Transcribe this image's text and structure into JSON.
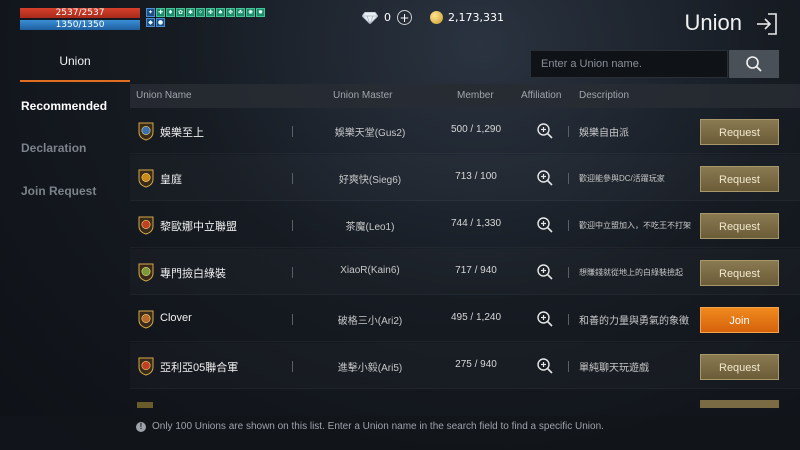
{
  "status": {
    "hp": "2537/2537",
    "mp": "1350/1350",
    "hp_fraction": 1.0,
    "mp_fraction": 1.0
  },
  "currency": {
    "diamonds": "0",
    "gold": "2,173,331"
  },
  "window": {
    "title": "Union"
  },
  "tab": {
    "label": "Union"
  },
  "search": {
    "placeholder": "Enter a Union name."
  },
  "sidebar": {
    "items": [
      {
        "label": "Recommended",
        "active": true
      },
      {
        "label": "Declaration",
        "active": false
      },
      {
        "label": "Join Request",
        "active": false
      }
    ]
  },
  "table": {
    "headers": {
      "name": "Union Name",
      "master": "Union Master",
      "member": "Member",
      "affiliation": "Affiliation",
      "description": "Description"
    },
    "rows": [
      {
        "name": "娛樂至上",
        "master": "娛樂天堂(Gus2)",
        "member": "500 / 1,290",
        "description": "娛樂自由派",
        "action": "Request",
        "emblem_color": "#3a6fb0"
      },
      {
        "name": "皇庭",
        "master": "好爽快(Sieg6)",
        "member": "713 / 100",
        "description": "歡迎能參與DC/活躍玩家",
        "action": "Request",
        "emblem_color": "#c98a1a"
      },
      {
        "name": "黎歐娜中立聯盟",
        "master": "茶魔(Leo1)",
        "member": "744 / 1,330",
        "description": "歡迎中立盟加入，不吃王不打架",
        "action": "Request",
        "emblem_color": "#c04020"
      },
      {
        "name": "專門撿白綠裝",
        "master": "XiaoR(Kain6)",
        "member": "717 / 940",
        "description": "想賺錢就從地上的白綠裝撿起",
        "action": "Request",
        "emblem_color": "#7a9a3a"
      },
      {
        "name": "Clover",
        "master": "破格三小(Ari2)",
        "member": "495 / 1,240",
        "description": "和善的力量與勇氣的象徵",
        "action": "Join",
        "emblem_color": "#b86a2a"
      },
      {
        "name": "亞利亞05聯合軍",
        "master": "進擊小毅(Ari5)",
        "member": "275 / 940",
        "description": "單純聊天玩遊戲",
        "action": "Request",
        "emblem_color": "#c04020"
      }
    ]
  },
  "footer": {
    "notice": "Only 100 Unions are shown on this list. Enter a Union name in the search field to find a specific Union."
  }
}
